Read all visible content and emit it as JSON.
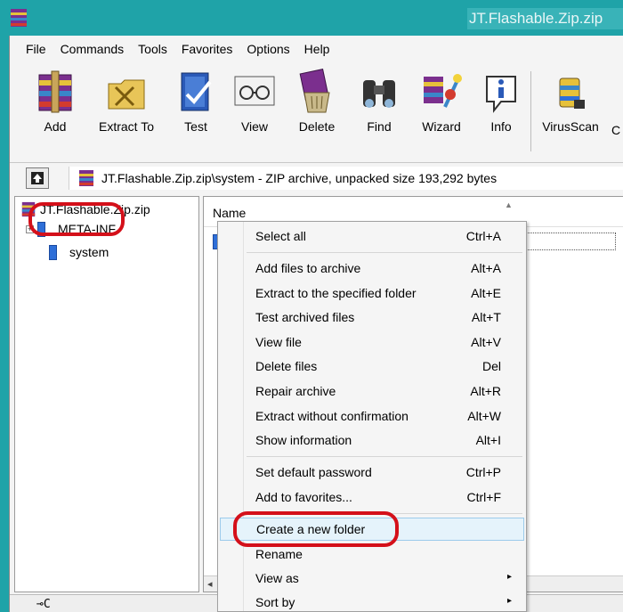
{
  "window": {
    "title": "JT.Flashable.Zip.zip"
  },
  "menubar": [
    "File",
    "Commands",
    "Tools",
    "Favorites",
    "Options",
    "Help"
  ],
  "toolbar": {
    "add": "Add",
    "extract_to": "Extract To",
    "test": "Test",
    "view": "View",
    "delete": "Delete",
    "find": "Find",
    "wizard": "Wizard",
    "info": "Info",
    "virusscan": "VirusScan",
    "cut_label": "C"
  },
  "address": {
    "path": "JT.Flashable.Zip.zip\\system - ZIP archive, unpacked size 193,292 bytes"
  },
  "tree": {
    "root": "JT.Flashable.Zip.zip",
    "items": [
      "META-INF",
      "system"
    ]
  },
  "files": {
    "column_name": "Name",
    "up_row": ".."
  },
  "status": {
    "icon_text": "⊸C"
  },
  "context_menu": {
    "items": [
      {
        "label": "Select all",
        "shortcut": "Ctrl+A"
      },
      {
        "label": "Add files to archive",
        "shortcut": "Alt+A"
      },
      {
        "label": "Extract to the specified folder",
        "shortcut": "Alt+E"
      },
      {
        "label": "Test archived files",
        "shortcut": "Alt+T"
      },
      {
        "label": "View file",
        "shortcut": "Alt+V"
      },
      {
        "label": "Delete files",
        "shortcut": "Del"
      },
      {
        "label": "Repair archive",
        "shortcut": "Alt+R"
      },
      {
        "label": "Extract without confirmation",
        "shortcut": "Alt+W"
      },
      {
        "label": "Show information",
        "shortcut": "Alt+I"
      },
      {
        "label": "Set default password",
        "shortcut": "Ctrl+P"
      },
      {
        "label": "Add to favorites...",
        "shortcut": "Ctrl+F"
      },
      {
        "label": "Create a new folder",
        "shortcut": ""
      },
      {
        "label": "Rename",
        "shortcut": ""
      },
      {
        "label": "View as",
        "shortcut": ""
      },
      {
        "label": "Sort by",
        "shortcut": ""
      }
    ]
  },
  "colors": {
    "window_frame": "#1fa3a8",
    "highlight_oval": "#d4101a",
    "menu_hover": "#e5f3fb"
  }
}
